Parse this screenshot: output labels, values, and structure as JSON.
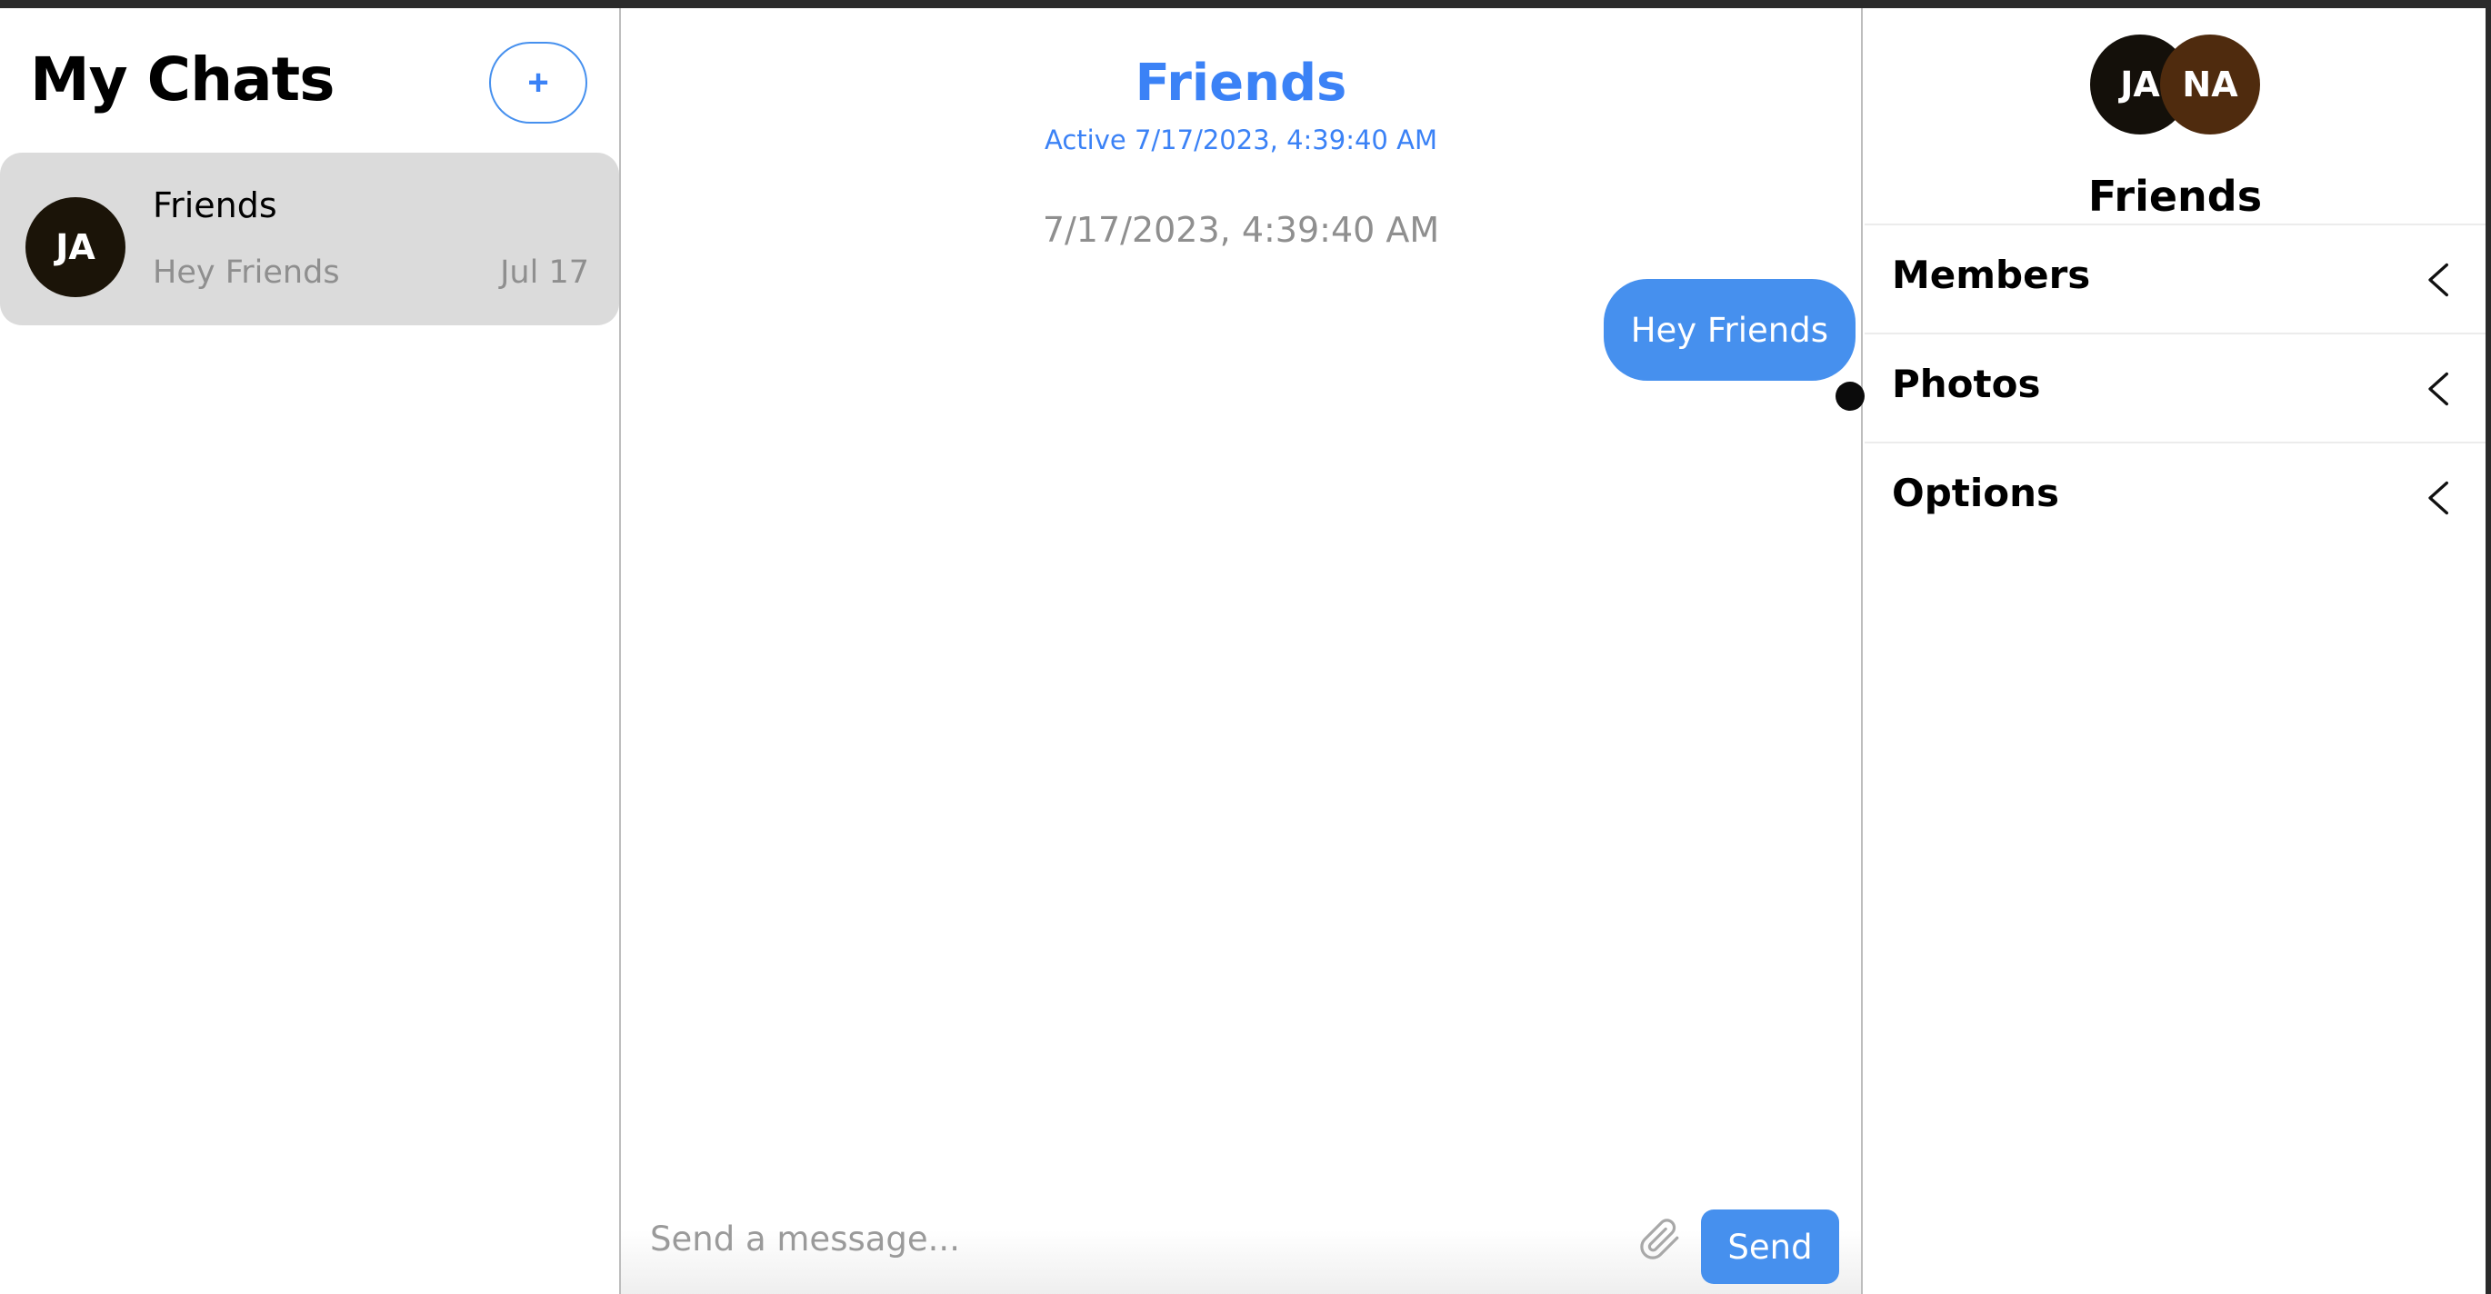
{
  "left": {
    "title": "My Chats",
    "new_chat_label": "+",
    "chats": [
      {
        "initials": "JA",
        "title": "Friends",
        "preview": "Hey Friends",
        "date": "Jul 17"
      }
    ]
  },
  "chat": {
    "title": "Friends",
    "status": "Active 7/17/2023, 4:39:40 AM",
    "date_divider": "7/17/2023, 4:39:40 AM",
    "messages": [
      {
        "text": "Hey Friends",
        "sent": true
      }
    ],
    "composer": {
      "placeholder": "Send a message...",
      "attach_icon": "paperclip-icon",
      "send_label": "Send"
    }
  },
  "details": {
    "avatars": [
      "JA",
      "NA"
    ],
    "title": "Friends",
    "sections": [
      {
        "label": "Members",
        "icon": "chevron-left-icon"
      },
      {
        "label": "Photos",
        "icon": "chevron-left-icon"
      },
      {
        "label": "Options",
        "icon": "chevron-left-icon"
      }
    ]
  },
  "colors": {
    "accent": "#4690ee",
    "selected_chat_bg": "#dbdbdb",
    "muted_text": "#8f8f8f",
    "avatar_ja": "#1b1408",
    "avatar_na": "#4f2b0e"
  }
}
